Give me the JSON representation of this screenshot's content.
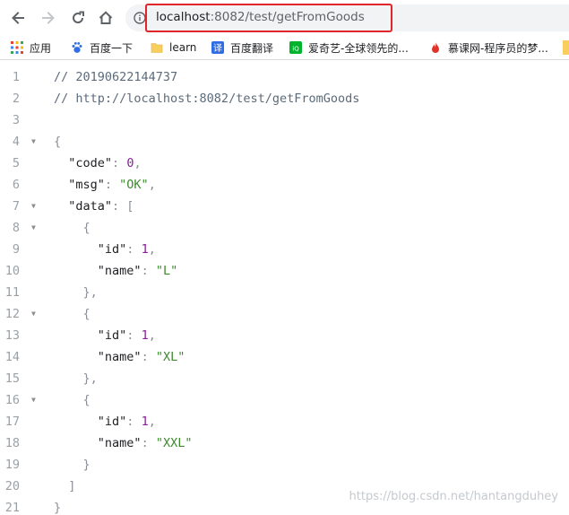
{
  "toolbar": {
    "url_host": "localhost",
    "url_rest": ":8082/test/getFromGoods"
  },
  "bookmarks": [
    {
      "label": "应用",
      "icon": "apps-grid-icon"
    },
    {
      "label": "百度一下",
      "icon": "baidu-paw-icon"
    },
    {
      "label": "learn",
      "icon": "folder-icon"
    },
    {
      "label": "百度翻译",
      "icon": "translate-icon"
    },
    {
      "label": "爱奇艺-全球领先的...",
      "icon": "iqiyi-icon"
    },
    {
      "label": "慕课网-程序员的梦...",
      "icon": "flame-icon"
    }
  ],
  "code": {
    "lines": [
      {
        "n": "1",
        "fold": "",
        "indent": "",
        "tokens": [
          {
            "t": "// 20190622144737",
            "c": "comment"
          }
        ]
      },
      {
        "n": "2",
        "fold": "",
        "indent": "",
        "tokens": [
          {
            "t": "// http://localhost:8082/test/getFromGoods",
            "c": "comment"
          }
        ]
      },
      {
        "n": "3",
        "fold": "",
        "indent": "",
        "tokens": []
      },
      {
        "n": "4",
        "fold": "▼",
        "indent": "",
        "tokens": [
          {
            "t": "{",
            "c": "punc"
          }
        ]
      },
      {
        "n": "5",
        "fold": "",
        "indent": "  ",
        "tokens": [
          {
            "t": "\"code\"",
            "c": "key"
          },
          {
            "t": ": ",
            "c": "punc"
          },
          {
            "t": "0",
            "c": "num"
          },
          {
            "t": ",",
            "c": "punc"
          }
        ]
      },
      {
        "n": "6",
        "fold": "",
        "indent": "  ",
        "tokens": [
          {
            "t": "\"msg\"",
            "c": "key"
          },
          {
            "t": ": ",
            "c": "punc"
          },
          {
            "t": "\"OK\"",
            "c": "str"
          },
          {
            "t": ",",
            "c": "punc"
          }
        ]
      },
      {
        "n": "7",
        "fold": "▼",
        "indent": "  ",
        "tokens": [
          {
            "t": "\"data\"",
            "c": "key"
          },
          {
            "t": ": [",
            "c": "punc"
          }
        ]
      },
      {
        "n": "8",
        "fold": "▼",
        "indent": "    ",
        "tokens": [
          {
            "t": "{",
            "c": "punc"
          }
        ]
      },
      {
        "n": "9",
        "fold": "",
        "indent": "      ",
        "tokens": [
          {
            "t": "\"id\"",
            "c": "key"
          },
          {
            "t": ": ",
            "c": "punc"
          },
          {
            "t": "1",
            "c": "num"
          },
          {
            "t": ",",
            "c": "punc"
          }
        ]
      },
      {
        "n": "10",
        "fold": "",
        "indent": "      ",
        "tokens": [
          {
            "t": "\"name\"",
            "c": "key"
          },
          {
            "t": ": ",
            "c": "punc"
          },
          {
            "t": "\"L\"",
            "c": "str"
          }
        ]
      },
      {
        "n": "11",
        "fold": "",
        "indent": "    ",
        "tokens": [
          {
            "t": "},",
            "c": "punc"
          }
        ]
      },
      {
        "n": "12",
        "fold": "▼",
        "indent": "    ",
        "tokens": [
          {
            "t": "{",
            "c": "punc"
          }
        ]
      },
      {
        "n": "13",
        "fold": "",
        "indent": "      ",
        "tokens": [
          {
            "t": "\"id\"",
            "c": "key"
          },
          {
            "t": ": ",
            "c": "punc"
          },
          {
            "t": "1",
            "c": "num"
          },
          {
            "t": ",",
            "c": "punc"
          }
        ]
      },
      {
        "n": "14",
        "fold": "",
        "indent": "      ",
        "tokens": [
          {
            "t": "\"name\"",
            "c": "key"
          },
          {
            "t": ": ",
            "c": "punc"
          },
          {
            "t": "\"XL\"",
            "c": "str"
          }
        ]
      },
      {
        "n": "15",
        "fold": "",
        "indent": "    ",
        "tokens": [
          {
            "t": "},",
            "c": "punc"
          }
        ]
      },
      {
        "n": "16",
        "fold": "▼",
        "indent": "    ",
        "tokens": [
          {
            "t": "{",
            "c": "punc"
          }
        ]
      },
      {
        "n": "17",
        "fold": "",
        "indent": "      ",
        "tokens": [
          {
            "t": "\"id\"",
            "c": "key"
          },
          {
            "t": ": ",
            "c": "punc"
          },
          {
            "t": "1",
            "c": "num"
          },
          {
            "t": ",",
            "c": "punc"
          }
        ]
      },
      {
        "n": "18",
        "fold": "",
        "indent": "      ",
        "tokens": [
          {
            "t": "\"name\"",
            "c": "key"
          },
          {
            "t": ": ",
            "c": "punc"
          },
          {
            "t": "\"XXL\"",
            "c": "str"
          }
        ]
      },
      {
        "n": "19",
        "fold": "",
        "indent": "    ",
        "tokens": [
          {
            "t": "}",
            "c": "punc"
          }
        ]
      },
      {
        "n": "20",
        "fold": "",
        "indent": "  ",
        "tokens": [
          {
            "t": "]",
            "c": "punc"
          }
        ]
      },
      {
        "n": "21",
        "fold": "",
        "indent": "",
        "tokens": [
          {
            "t": "}",
            "c": "punc"
          }
        ]
      }
    ]
  },
  "watermark": "https://blog.csdn.net/hantangduhey",
  "colors": {
    "highlight_box": "#e0262a",
    "number": "#8a1c9c",
    "string": "#3b8b2c",
    "comment": "#5c6b7a"
  }
}
